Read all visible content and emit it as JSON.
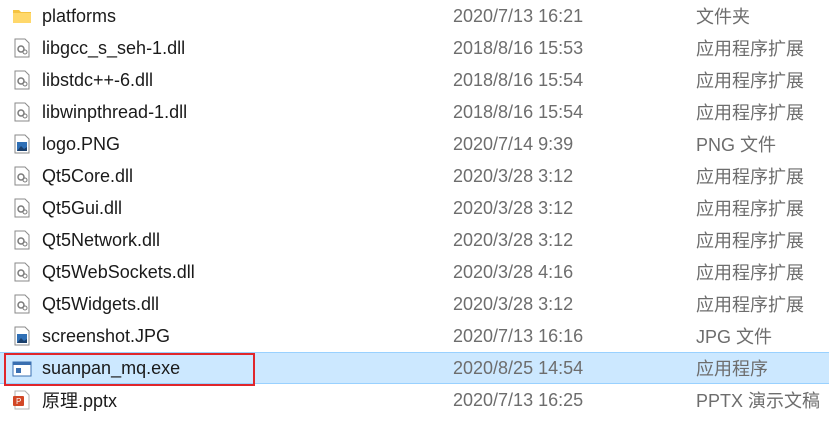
{
  "files": [
    {
      "name": "platforms",
      "date": "2020/7/13 16:21",
      "type": "文件夹",
      "icon": "folder-icon"
    },
    {
      "name": "libgcc_s_seh-1.dll",
      "date": "2018/8/16 15:53",
      "type": "应用程序扩展",
      "icon": "dll-icon"
    },
    {
      "name": "libstdc++-6.dll",
      "date": "2018/8/16 15:54",
      "type": "应用程序扩展",
      "icon": "dll-icon"
    },
    {
      "name": "libwinpthread-1.dll",
      "date": "2018/8/16 15:54",
      "type": "应用程序扩展",
      "icon": "dll-icon"
    },
    {
      "name": "logo.PNG",
      "date": "2020/7/14 9:39",
      "type": "PNG 文件",
      "icon": "image-icon"
    },
    {
      "name": "Qt5Core.dll",
      "date": "2020/3/28 3:12",
      "type": "应用程序扩展",
      "icon": "dll-icon"
    },
    {
      "name": "Qt5Gui.dll",
      "date": "2020/3/28 3:12",
      "type": "应用程序扩展",
      "icon": "dll-icon"
    },
    {
      "name": "Qt5Network.dll",
      "date": "2020/3/28 3:12",
      "type": "应用程序扩展",
      "icon": "dll-icon"
    },
    {
      "name": "Qt5WebSockets.dll",
      "date": "2020/3/28 4:16",
      "type": "应用程序扩展",
      "icon": "dll-icon"
    },
    {
      "name": "Qt5Widgets.dll",
      "date": "2020/3/28 3:12",
      "type": "应用程序扩展",
      "icon": "dll-icon"
    },
    {
      "name": "screenshot.JPG",
      "date": "2020/7/13 16:16",
      "type": "JPG 文件",
      "icon": "image-icon"
    },
    {
      "name": "suanpan_mq.exe",
      "date": "2020/8/25 14:54",
      "type": "应用程序",
      "icon": "exe-icon",
      "selected": true
    },
    {
      "name": "原理.pptx",
      "date": "2020/7/13 16:25",
      "type": "PPTX 演示文稿",
      "icon": "pptx-icon"
    }
  ],
  "colors": {
    "selection": "#cce8ff",
    "highlight_border": "#e0262b",
    "folder": "#f5c342"
  }
}
